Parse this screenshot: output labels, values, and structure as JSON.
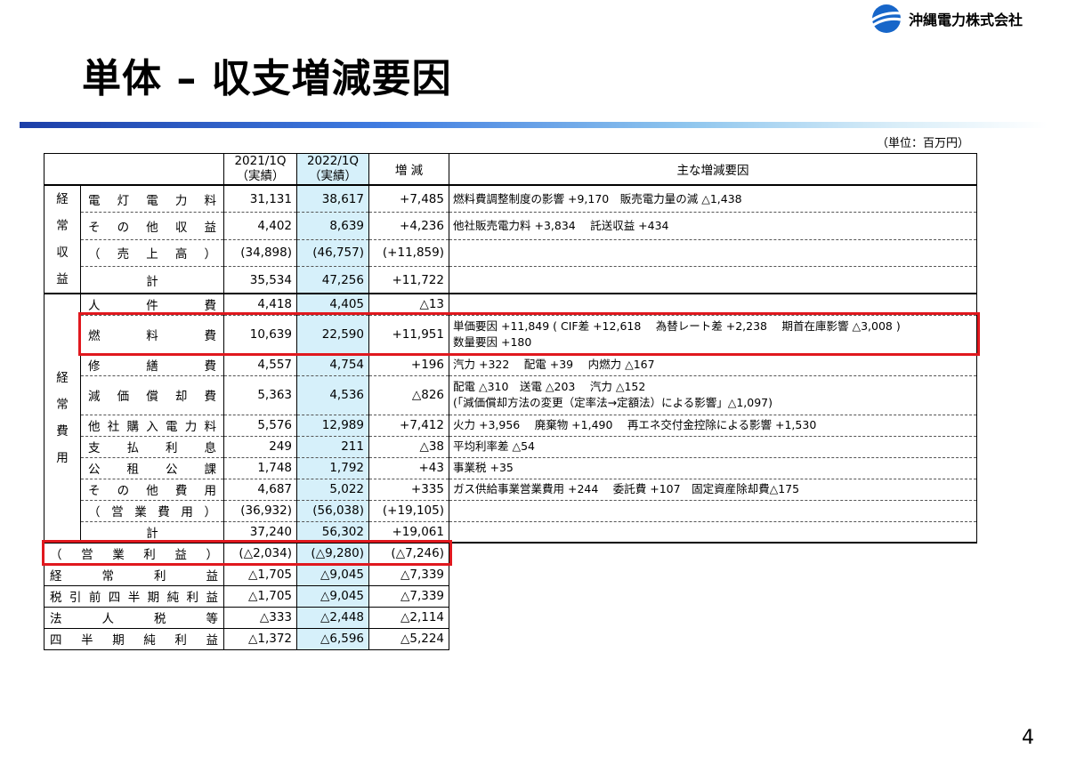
{
  "company": {
    "name": "沖縄電力株式会社"
  },
  "title": "単体 – 収支増減要因",
  "unit": "（単位：百万円）",
  "page_number": "4",
  "header": {
    "col_2021": [
      "2021/1Q",
      "（実績）"
    ],
    "col_2022": [
      "2022/1Q",
      "（実績）"
    ],
    "col_diff": "増 減",
    "col_factors": "主な増減要因"
  },
  "groups": {
    "revenue": "経常収益",
    "expense": "経常費用"
  },
  "revenue": [
    {
      "label": "電灯電力料",
      "v2021": "31,131",
      "v2022": "38,617",
      "diff": "+7,485",
      "factors": [
        "燃料費調整制度の影響 +9,170　販売電力量の減 △1,438"
      ]
    },
    {
      "label": "その他収益",
      "v2021": "4,402",
      "v2022": "8,639",
      "diff": "+4,236",
      "factors": [
        "他社販売電力料 +3,834　 託送収益 +434"
      ]
    },
    {
      "label": "（売上高）",
      "v2021": "(34,898)",
      "v2022": "(46,757)",
      "diff": "(+11,859)",
      "factors": []
    },
    {
      "label": "計",
      "v2021": "35,534",
      "v2022": "47,256",
      "diff": "+11,722",
      "factors": []
    }
  ],
  "expense": [
    {
      "label": "人件費",
      "v2021": "4,418",
      "v2022": "4,405",
      "diff": "△13",
      "factors": []
    },
    {
      "label": "燃料費",
      "v2021": "10,639",
      "v2022": "22,590",
      "diff": "+11,951",
      "factors": [
        "単価要因 +11,849 ( CIF差 +12,618　 為替レート差 +2,238　 期首在庫影響 △3,008 )",
        "数量要因 +180"
      ]
    },
    {
      "label": "修繕費",
      "v2021": "4,557",
      "v2022": "4,754",
      "diff": "+196",
      "factors": [
        "汽力 +322　 配電 +39　 内燃力 △167"
      ]
    },
    {
      "label": "減価償却費",
      "v2021": "5,363",
      "v2022": "4,536",
      "diff": "△826",
      "factors": [
        "配電 △310　送電 △203　 汽力 △152",
        "(「減価償却方法の変更（定率法→定額法）による影響」△1,097)"
      ]
    },
    {
      "label": "他社購入電力料",
      "v2021": "5,576",
      "v2022": "12,989",
      "diff": "+7,412",
      "factors": [
        "火力 +3,956　 廃棄物 +1,490　 再エネ交付金控除による影響 +1,530"
      ]
    },
    {
      "label": "支払利息",
      "v2021": "249",
      "v2022": "211",
      "diff": "△38",
      "factors": [
        "平均利率差 △54"
      ]
    },
    {
      "label": "公租公課",
      "v2021": "1,748",
      "v2022": "1,792",
      "diff": "+43",
      "factors": [
        "事業税 +35"
      ]
    },
    {
      "label": "その他費用",
      "v2021": "4,687",
      "v2022": "5,022",
      "diff": "+335",
      "factors": [
        "ガス供給事業営業費用 +244　 委託費 +107　固定資産除却費△175"
      ]
    },
    {
      "label": "（営業費用）",
      "v2021": "(36,932)",
      "v2022": "(56,038)",
      "diff": "(+19,105)",
      "factors": []
    },
    {
      "label": "計",
      "v2021": "37,240",
      "v2022": "56,302",
      "diff": "+19,061",
      "factors": []
    }
  ],
  "summary": [
    {
      "label": "（営業利益）",
      "v2021": "(△2,034)",
      "v2022": "(△9,280)",
      "diff": "(△7,246)"
    },
    {
      "label": "経常利益",
      "v2021": "△1,705",
      "v2022": "△9,045",
      "diff": "△7,339"
    },
    {
      "label": "税引前四半期純利益",
      "v2021": "△1,705",
      "v2022": "△9,045",
      "diff": "△7,339"
    },
    {
      "label": "法人税等",
      "v2021": "△333",
      "v2022": "△2,448",
      "diff": "△2,114"
    },
    {
      "label": "四半期純利益",
      "v2021": "△1,372",
      "v2022": "△6,596",
      "diff": "△5,224"
    }
  ],
  "colors": {
    "highlight": "#e0181e",
    "col_2022_bg": "#d6f0fa"
  }
}
